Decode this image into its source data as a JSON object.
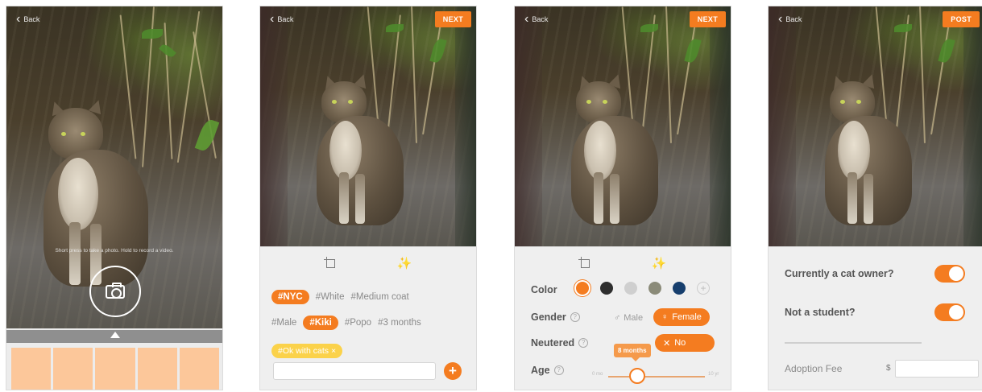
{
  "common": {
    "back_label": "Back"
  },
  "screen1": {
    "hint": "Short press to take a photo. Hold to record a video."
  },
  "screen2": {
    "next_label": "NEXT",
    "tags_row1": [
      "#NYC",
      "#White",
      "#Medium coat"
    ],
    "tags_row2": [
      "#Male",
      "#Kiki",
      "#Popo",
      "#3 months"
    ],
    "tag_extra": "#Ok with cats",
    "tag_extra_close": "×",
    "add_symbol": "+"
  },
  "screen3": {
    "next_label": "NEXT",
    "color_label": "Color",
    "gender_label": "Gender",
    "neutered_label": "Neutered",
    "age_label": "Age",
    "help_symbol": "?",
    "gender_male": "Male",
    "gender_female": "Female",
    "neutered_no": "No",
    "age_tooltip": "8 months",
    "colors": [
      "#f47c20",
      "#2e2e2e",
      "#cfcfcf",
      "#8b8b79",
      "#163e6d"
    ],
    "add_color_symbol": "+",
    "slider_min": "0 mo",
    "slider_max": "10 yr",
    "age_fraction": 0.3
  },
  "screen4": {
    "post_label": "POST",
    "q1": "Currently a cat owner?",
    "q2": "Not a student?",
    "q1_on": true,
    "q2_on": true,
    "fee_label": "Adoption Fee",
    "currency": "$"
  },
  "colors": {
    "accent": "#f47c20",
    "thumb": "#fcc79a",
    "tag_yellow": "#fbd24a"
  }
}
